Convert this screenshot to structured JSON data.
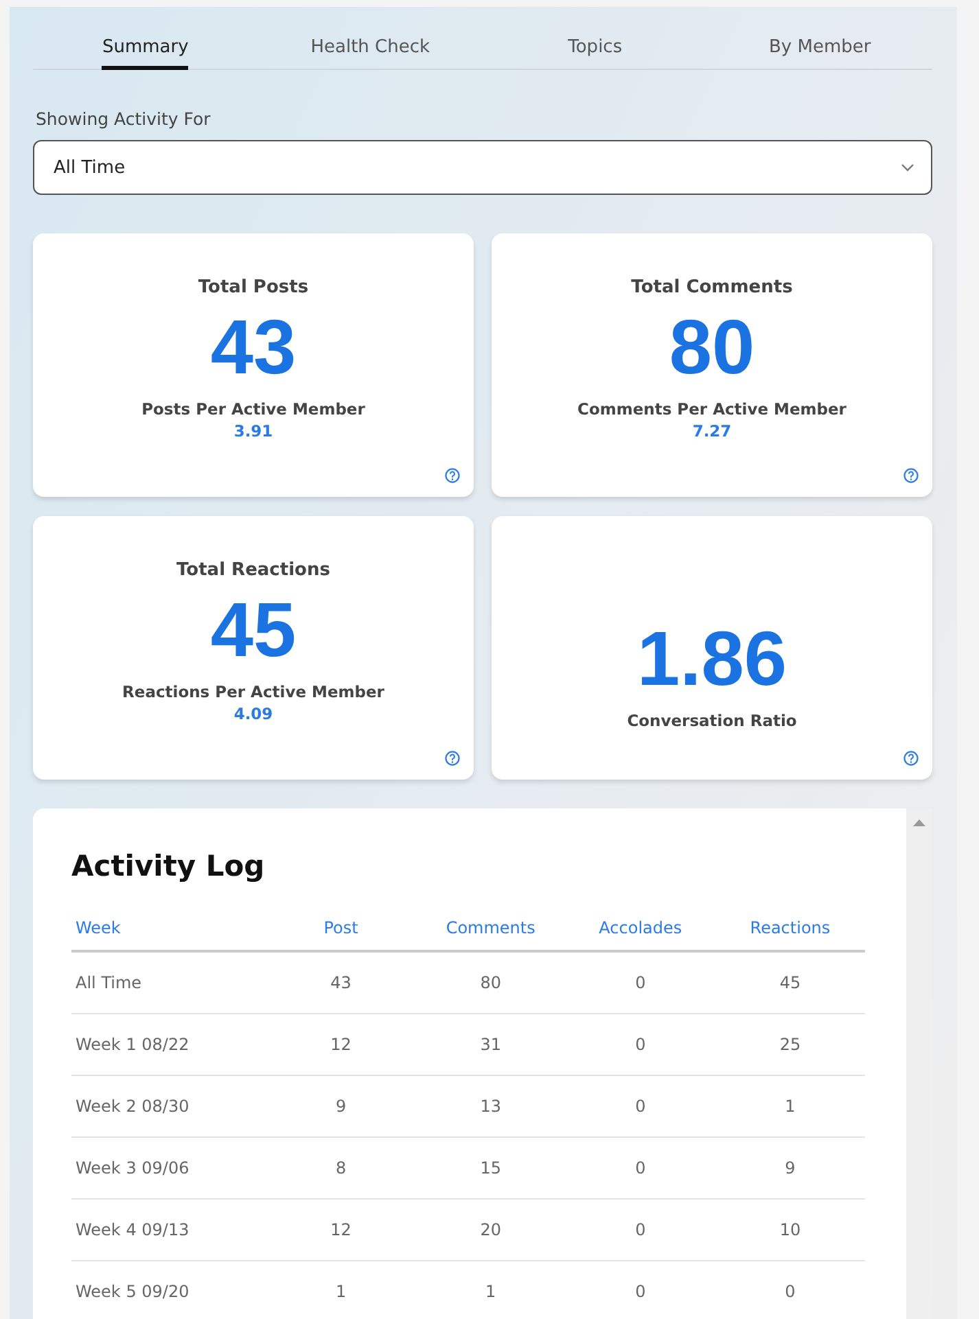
{
  "tabs": [
    {
      "label": "Summary",
      "selected": true
    },
    {
      "label": "Health Check",
      "selected": false
    },
    {
      "label": "Topics",
      "selected": false
    },
    {
      "label": "By Member",
      "selected": false
    }
  ],
  "filter": {
    "label": "Showing Activity For",
    "value": "All Time"
  },
  "stats": [
    {
      "title": "Total Posts",
      "value": "43",
      "sub_label": "Posts Per Active Member",
      "sub_value": "3.91"
    },
    {
      "title": "Total Comments",
      "value": "80",
      "sub_label": "Comments Per Active Member",
      "sub_value": "7.27"
    },
    {
      "title": "Total Reactions",
      "value": "45",
      "sub_label": "Reactions Per Active Member",
      "sub_value": "4.09"
    },
    {
      "value": "1.86",
      "sub_label": "Conversation Ratio"
    }
  ],
  "activity_log": {
    "title": "Activity Log",
    "columns": [
      "Week",
      "Post",
      "Comments",
      "Accolades",
      "Reactions"
    ],
    "rows": [
      [
        "All Time",
        "43",
        "80",
        "0",
        "45"
      ],
      [
        "Week 1 08/22",
        "12",
        "31",
        "0",
        "25"
      ],
      [
        "Week 2 08/30",
        "9",
        "13",
        "0",
        "1"
      ],
      [
        "Week 3 09/06",
        "8",
        "15",
        "0",
        "9"
      ],
      [
        "Week 4 09/13",
        "12",
        "20",
        "0",
        "10"
      ],
      [
        "Week 5 09/20",
        "1",
        "1",
        "0",
        "0"
      ]
    ]
  }
}
